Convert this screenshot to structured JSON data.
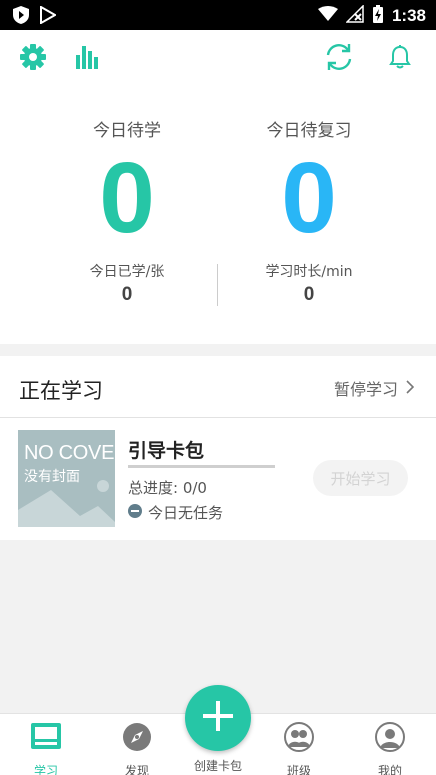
{
  "status_bar": {
    "time": "1:38"
  },
  "stats": {
    "today_to_learn_label": "今日待学",
    "today_to_learn_value": "0",
    "today_to_review_label": "今日待复习",
    "today_to_review_value": "0",
    "today_learned_label": "今日已学/张",
    "today_learned_value": "0",
    "study_time_label": "学习时长/min",
    "study_time_value": "0"
  },
  "learning": {
    "title": "正在学习",
    "pause_label": "暂停学习",
    "deck": {
      "cover_en": "NO COVER",
      "cover_zh": "没有封面",
      "name": "引导卡包",
      "progress_text": "总进度: 0/0",
      "progress_fraction": 0,
      "task_text": "今日无任务",
      "start_label": "开始学习"
    }
  },
  "bottom_nav": {
    "items": [
      {
        "label": "学习"
      },
      {
        "label": "发现"
      },
      {
        "label": "创建卡包"
      },
      {
        "label": "班级"
      },
      {
        "label": "我的"
      }
    ]
  },
  "colors": {
    "accent": "#26c6a6",
    "review_blue": "#29b6f6",
    "cover_bg": "#a9bec1"
  },
  "icons": [
    "settings-gear-icon",
    "statistics-bars-icon",
    "sync-icon",
    "bell-icon",
    "study-book-icon",
    "compass-icon",
    "plus-icon",
    "group-icon",
    "person-icon"
  ]
}
